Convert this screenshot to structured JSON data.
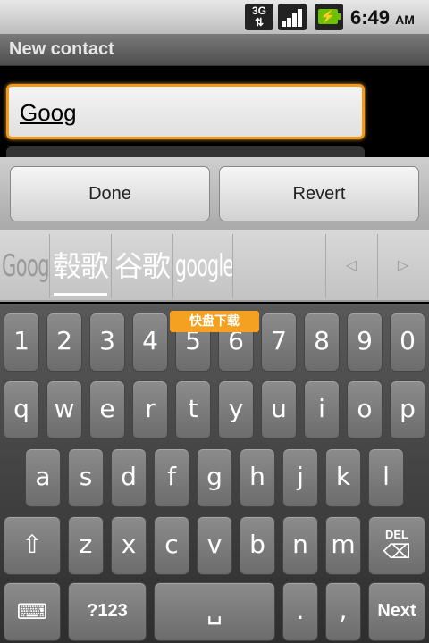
{
  "status_bar": {
    "network": "3G",
    "time": "6:49",
    "ampm": "AM",
    "icons": [
      "network-3g-icon",
      "signal-strength-icon",
      "battery-charging-icon"
    ],
    "battery_color": "#6cc000"
  },
  "title": "New contact",
  "name_field": {
    "value": "Goog",
    "focus_color": "#f49a1a"
  },
  "buttons": {
    "done": "Done",
    "revert": "Revert"
  },
  "suggestions": [
    "Goog",
    "毂歌",
    "谷歌",
    "google"
  ],
  "suggestion_nav": {
    "prev_icon": "arrow-left-icon",
    "next_icon": "arrow-right-icon"
  },
  "watermark": "快盘下载",
  "keyboard": {
    "row_numbers": [
      "1",
      "2",
      "3",
      "4",
      "5",
      "6",
      "7",
      "8",
      "9",
      "0"
    ],
    "row_1": [
      "q",
      "w",
      "e",
      "r",
      "t",
      "y",
      "u",
      "i",
      "o",
      "p"
    ],
    "row_2": [
      "a",
      "s",
      "d",
      "f",
      "g",
      "h",
      "j",
      "k",
      "l"
    ],
    "row_3": [
      "z",
      "x",
      "c",
      "v",
      "b",
      "n",
      "m"
    ],
    "del_label": "DEL",
    "symbols_label": "?123",
    "period": ".",
    "comma": ",",
    "next_label": "Next"
  }
}
